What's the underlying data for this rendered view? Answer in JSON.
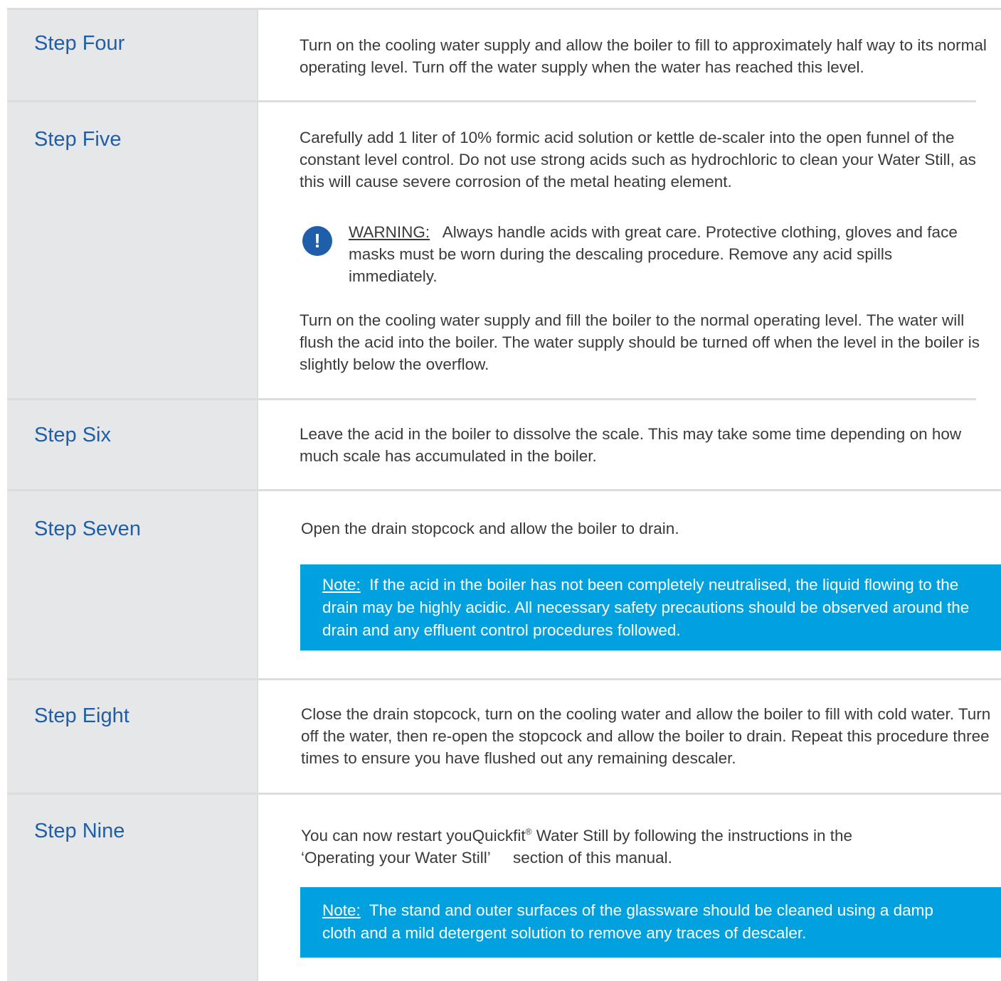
{
  "steps": {
    "four": {
      "title": "Step Four",
      "text": "Turn on the cooling water supply and allow the boiler to fill to approximately half way to its normal operating level. Turn off the water supply when the water has reached this level."
    },
    "five": {
      "title": "Step Five",
      "text1": "Carefully add 1 liter of 10% formic acid solution or kettle de-scaler into the open funnel of the constant level control. Do not use strong acids such as hydrochloric to clean your Water Still, as this will cause severe corrosion of the metal heating element.",
      "warning_label": "WARNING:",
      "warning_text": "Always handle acids with great care. Protective clothing, gloves and face masks must be worn during the descaling procedure. Remove any acid spills immediately.",
      "text2": "Turn on the cooling water supply and fill the boiler to the normal operating level. The water will flush the acid into the boiler. The water supply should be turned off when the level in the boiler is slightly below the overflow."
    },
    "six": {
      "title": "Step Six",
      "text": "Leave the acid in the boiler to dissolve the scale. This may take some time depending on how much scale has accumulated in the boiler."
    },
    "seven": {
      "title": "Step Seven",
      "text": "Open the drain stopcock and allow the boiler to drain.",
      "note_label": "Note:",
      "note_text": "If the acid in the boiler has not been completely neutralised, the liquid flowing to the drain may be highly acidic. All necessary safety precautions should be observed around the drain and any effluent control procedures followed."
    },
    "eight": {
      "title": "Step Eight",
      "text": "Close the drain stopcock, turn on the cooling water and allow the boiler to fill with cold water. Turn off the water, then re-open the stopcock and allow the boiler to drain. Repeat this procedure three times to ensure you have flushed out any remaining descaler."
    },
    "nine": {
      "title": "Step Nine",
      "text_before": "You can now restart you",
      "brand": "Quickfit",
      "reg": "®",
      "text_after": " Water Still by following the instructions in the",
      "text_line2a": "‘Operating your Water Still’",
      "text_line2b": "section of this manual.",
      "note_label": "Note:",
      "note_text": "The stand and outer surfaces of the glassware should be cleaned using a damp cloth and a mild detergent solution to remove any traces of descaler."
    }
  },
  "colors": {
    "title_blue": "#1f5ea8",
    "note_blue": "#00a1de",
    "left_gray": "#e6e7e8",
    "body_text": "#3a3a3a"
  },
  "icons": {
    "warning": "exclamation-circle-icon"
  }
}
